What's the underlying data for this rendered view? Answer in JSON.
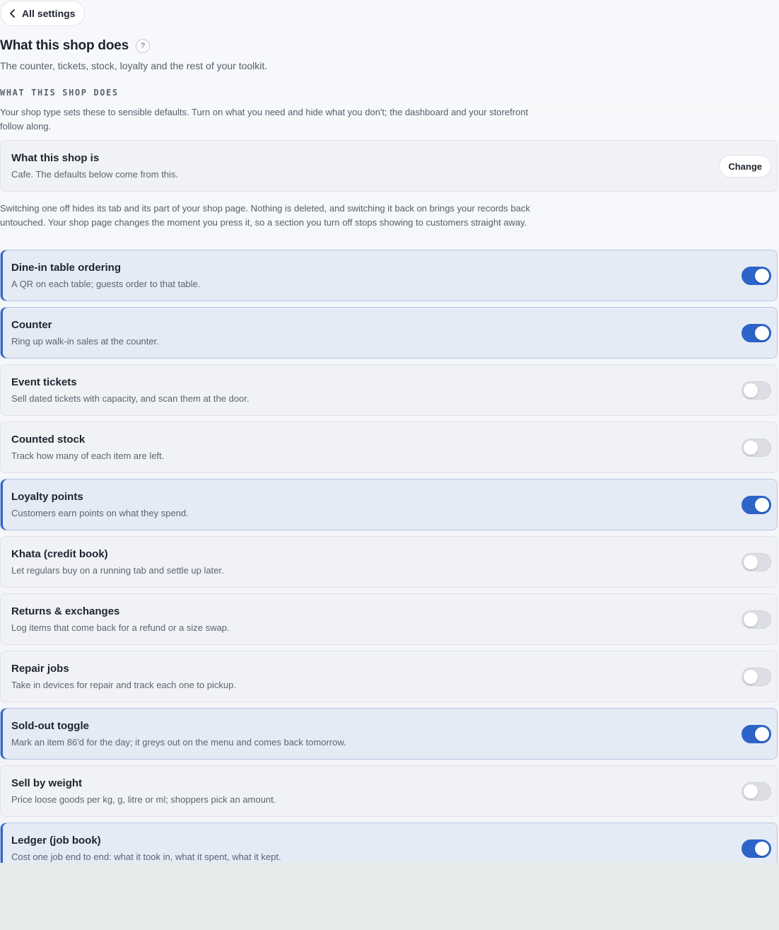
{
  "header": {
    "back_label": "All settings",
    "title": "What this shop does",
    "help_glyph": "?",
    "subtitle": "The counter, tickets, stock, loyalty and the rest of your toolkit."
  },
  "section": {
    "label": "WHAT THIS SHOP DOES",
    "intro": "Your shop type sets these to sensible defaults. Turn on what you need and hide what you don't; the dashboard and your storefront follow along."
  },
  "shop_type": {
    "title": "What this shop is",
    "description": "Cafe. The defaults below come from this.",
    "change_label": "Change"
  },
  "note": "Switching one off hides its tab and its part of your shop page. Nothing is deleted, and switching it back on brings your records back untouched. Your shop page changes the moment you press it, so a section you turn off stops showing to customers straight away.",
  "features": [
    {
      "title": "Dine-in table ordering",
      "description": "A QR on each table; guests order to that table.",
      "enabled": true
    },
    {
      "title": "Counter",
      "description": "Ring up walk-in sales at the counter.",
      "enabled": true
    },
    {
      "title": "Event tickets",
      "description": "Sell dated tickets with capacity, and scan them at the door.",
      "enabled": false
    },
    {
      "title": "Counted stock",
      "description": "Track how many of each item are left.",
      "enabled": false
    },
    {
      "title": "Loyalty points",
      "description": "Customers earn points on what they spend.",
      "enabled": true
    },
    {
      "title": "Khata (credit book)",
      "description": "Let regulars buy on a running tab and settle up later.",
      "enabled": false
    },
    {
      "title": "Returns & exchanges",
      "description": "Log items that come back for a refund or a size swap.",
      "enabled": false
    },
    {
      "title": "Repair jobs",
      "description": "Take in devices for repair and track each one to pickup.",
      "enabled": false
    },
    {
      "title": "Sold-out toggle",
      "description": "Mark an item 86'd for the day; it greys out on the menu and comes back tomorrow.",
      "enabled": true
    },
    {
      "title": "Sell by weight",
      "description": "Price loose goods per kg, g, litre or ml; shoppers pick an amount.",
      "enabled": false
    },
    {
      "title": "Ledger (job book)",
      "description": "Cost one job end to end: what it took in, what it spent, what it kept.",
      "enabled": true
    }
  ],
  "colors": {
    "accent": "#2d64c9",
    "enabled_card_bg": "#e5ebf5",
    "toggle_off": "#dcdee3"
  },
  "icons": {
    "back": "chevron-left-icon",
    "help": "question-icon"
  }
}
